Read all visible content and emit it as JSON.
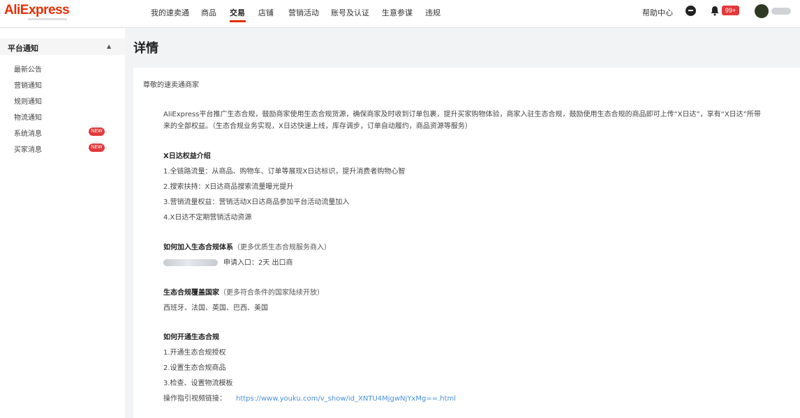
{
  "header": {
    "logo": "AliExpress",
    "nav": [
      "我的速卖通",
      "商品",
      "交易",
      "店铺",
      "营销活动",
      "账号及认证",
      "生意参谋",
      "违规"
    ],
    "active_nav": "交易",
    "help": "帮助中心",
    "notification_count": "99+"
  },
  "sidebar": {
    "section_title": "平台通知",
    "items": [
      {
        "label": "最新公告",
        "badge": ""
      },
      {
        "label": "营销通知",
        "badge": ""
      },
      {
        "label": "规则通知",
        "badge": ""
      },
      {
        "label": "物流通知",
        "badge": ""
      },
      {
        "label": "系统消息",
        "badge": "NEW"
      },
      {
        "label": "买家消息",
        "badge": "NEW"
      }
    ]
  },
  "main": {
    "title": "详情",
    "greeting": "尊敬的速卖通商家",
    "intro_line1": "AliExpress平台推广生态合规，鼓励商家使用生态合规货源，确保商家及时收到订单包裹，提升买家购物体验，商家入驻生态合规，鼓励使用生态合规的商品即可上传“X日达”，享有“X日达”所带",
    "intro_line2": "来的全部权益。（生态合规业务实现，X日达快速上线，库存调步，订单自动履约，商品资源等服务）",
    "sections": [
      {
        "title": "X日达权益介绍",
        "subtitle": "",
        "lines": [
          "1.全链路流量：从商品、购物车、订单等展现X日达标识，提升消费者购物心智",
          "2.搜索扶持：X日达商品搜索流量曝光提升",
          "3.营销流量权益：营销活动X日达商品参加平台活动流量加入",
          "4.X日达不定期营销活动资源"
        ]
      },
      {
        "title": "如何加入生态合规体系",
        "subtitle": "（更多优质生态合规服务商入）",
        "lines": [
          "申请入口：2天 出口商"
        ]
      },
      {
        "title": "生态合规覆盖国家",
        "subtitle": "（更多符合条件的国家陆续开放）",
        "lines": [
          "西班牙、法国、英国、巴西、美国"
        ]
      },
      {
        "title": "如何开通生态合规",
        "subtitle": "",
        "lines": [
          "1.开通生态合规授权",
          "2.设置生态合规商品",
          "3.检查、设置物流模板"
        ]
      }
    ],
    "video_label": "操作指引视频链接：",
    "video_url": "https://www.youku.com/v_show/id_XNTU4MjgwNjYxMg==.html"
  }
}
